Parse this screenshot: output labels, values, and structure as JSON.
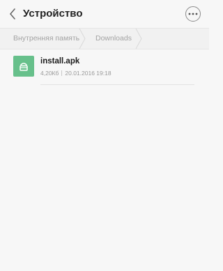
{
  "header": {
    "title": "Устройство",
    "back_icon": "chevron-left-icon",
    "more_icon": "more-horizontal-icon"
  },
  "breadcrumb": {
    "items": [
      {
        "label": "Внутренняя память"
      },
      {
        "label": "Downloads"
      }
    ]
  },
  "files": [
    {
      "name": "install.apk",
      "size": "4,20Кб",
      "date": "20.01.2016 19:18",
      "icon": "apk-file-icon",
      "icon_color": "#67c08b"
    }
  ],
  "colors": {
    "background": "#f7f7f7",
    "breadcrumb_background": "#f1f1f1",
    "apk_icon": "#67c08b"
  }
}
